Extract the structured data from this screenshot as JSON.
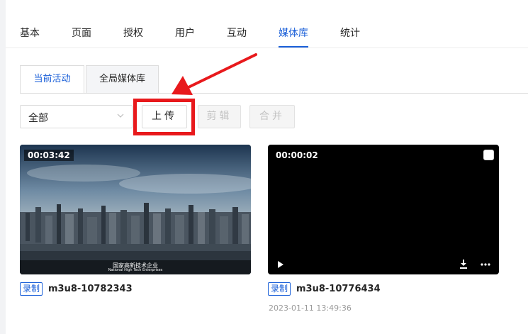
{
  "nav": {
    "tabs": [
      "基本",
      "页面",
      "授权",
      "用户",
      "互动",
      "媒体库",
      "统计"
    ],
    "active_index": 5
  },
  "subtabs": {
    "current": "当前活动",
    "global": "全局媒体库"
  },
  "toolbar": {
    "filter_value": "全部",
    "upload_label": "上传",
    "edit_label": "剪辑",
    "merge_label": "合并"
  },
  "videos": [
    {
      "duration": "00:03:42",
      "tag": "录制",
      "name": "m3u8-10782343",
      "caption_line1": "国家高新技术企业",
      "caption_line2": "National High Tech Enterprises"
    },
    {
      "duration": "00:00:02",
      "tag": "录制",
      "name": "m3u8-10776434",
      "date": "2023-01-11 13:49:36"
    }
  ],
  "colors": {
    "accent": "#1a5fd8",
    "highlight": "#e8191c"
  }
}
